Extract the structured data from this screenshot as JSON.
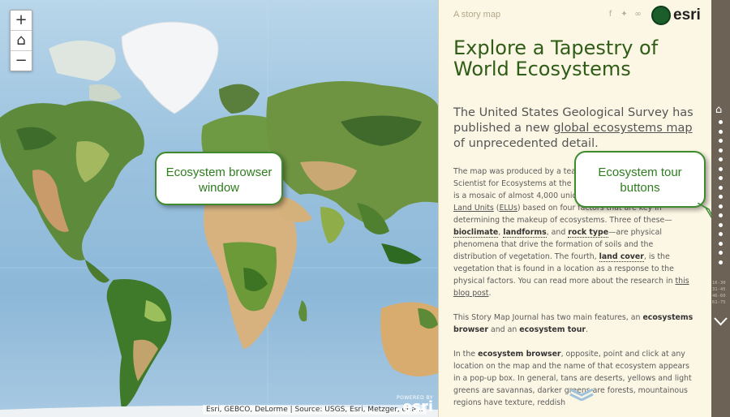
{
  "map": {
    "zoom_in": "+",
    "home": "⌂",
    "zoom_out": "−",
    "attribution": "Esri, GEBCO, DeLorme | Source: USGS, Esri, Metzger, et.a...",
    "powered_by": "POWERED BY",
    "powered_brand": "esri"
  },
  "callouts": {
    "browser_line1": "Ecosystem browser",
    "browser_line2": "window",
    "tour_line1": "Ecosystem tour",
    "tour_line2": "buttons"
  },
  "panel": {
    "story_label": "A story map",
    "brand": "esri",
    "share_icons": [
      "facebook-icon",
      "twitter-icon",
      "link-icon"
    ],
    "title": "Explore a Tapestry of World Ecosystems",
    "lead_1": "The United States Geological Survey has published a new ",
    "lead_link": "global ecosystems map",
    "lead_2": " of unprecedented detail.",
    "p1_a": "The map was produced by a team",
    "p1_b": "Scientist for Ecosystems at the USG",
    "p1_c": "is a mosaic of almost 4,000 unique",
    "p1_link_elu": "Land Units",
    "p1_elu_abbr": "ELUs",
    "p1_d": " based on four factors that are key in determining",
    "p1_e": "the makeup of ecosystems. Three of these—",
    "p1_bioclimate": "bioclimate",
    "p1_landforms": "landforms",
    "p1_and": "and ",
    "p1_rock": "rock type",
    "p1_f": "—are physical phenomena that drive the formation of soils and the distribution of vegetation. The fourth, ",
    "p1_land_cover": "land cover",
    "p1_g": ", is the vegetation that is found in a location as a response to the physical factors. You can read more about the research in ",
    "p1_blog": "this blog post",
    "p1_end": ".",
    "p2_a": "This Story Map Journal has two main features, an ",
    "p2_browser": "ecosystems browser",
    "p2_b": " and an ",
    "p2_tour": "ecosystem tour",
    "p2_end": ".",
    "p3_a": "In the ",
    "p3_browser": "ecosystem browser",
    "p3_b": ", opposite, point and click at any location on the map and the name of that ecosystem appears in a pop-up box. In general, tans are deserts, yellows and light greens are savannas, darker greens are forests, mountainous regions have texture, reddish"
  },
  "nav": {
    "home_icon": "home-icon",
    "dot_count": 16,
    "page_ranges": [
      "16-30",
      "31-45",
      "46-60",
      "61-75"
    ]
  },
  "colors": {
    "title_green": "#2f5d17",
    "panel_bg": "#fcf6e4",
    "nav_bg": "#6d6256",
    "callout_border": "#3f8a2f"
  }
}
